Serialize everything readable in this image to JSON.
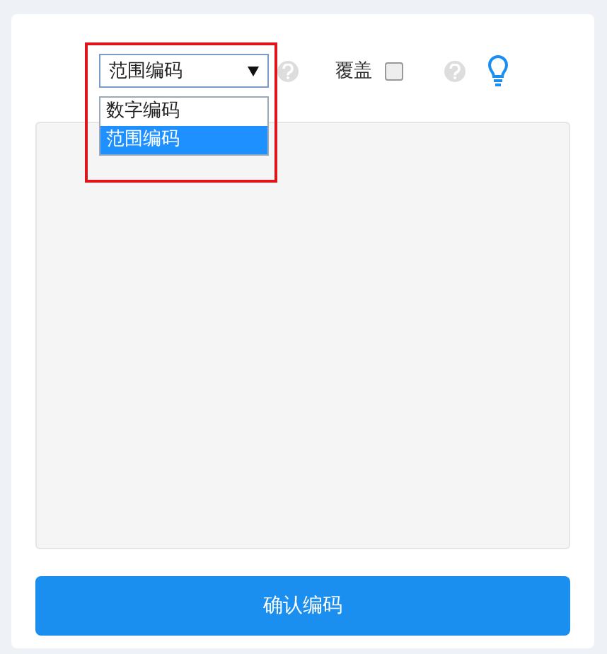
{
  "encoding_select": {
    "value": "范围编码",
    "expanded": true,
    "highlighted": true,
    "options": [
      {
        "label": "数字编码",
        "selected": false
      },
      {
        "label": "范围编码",
        "selected": true
      }
    ]
  },
  "overwrite": {
    "label": "覆盖",
    "checked": false
  },
  "confirm_button": {
    "label": "确认编码"
  }
}
